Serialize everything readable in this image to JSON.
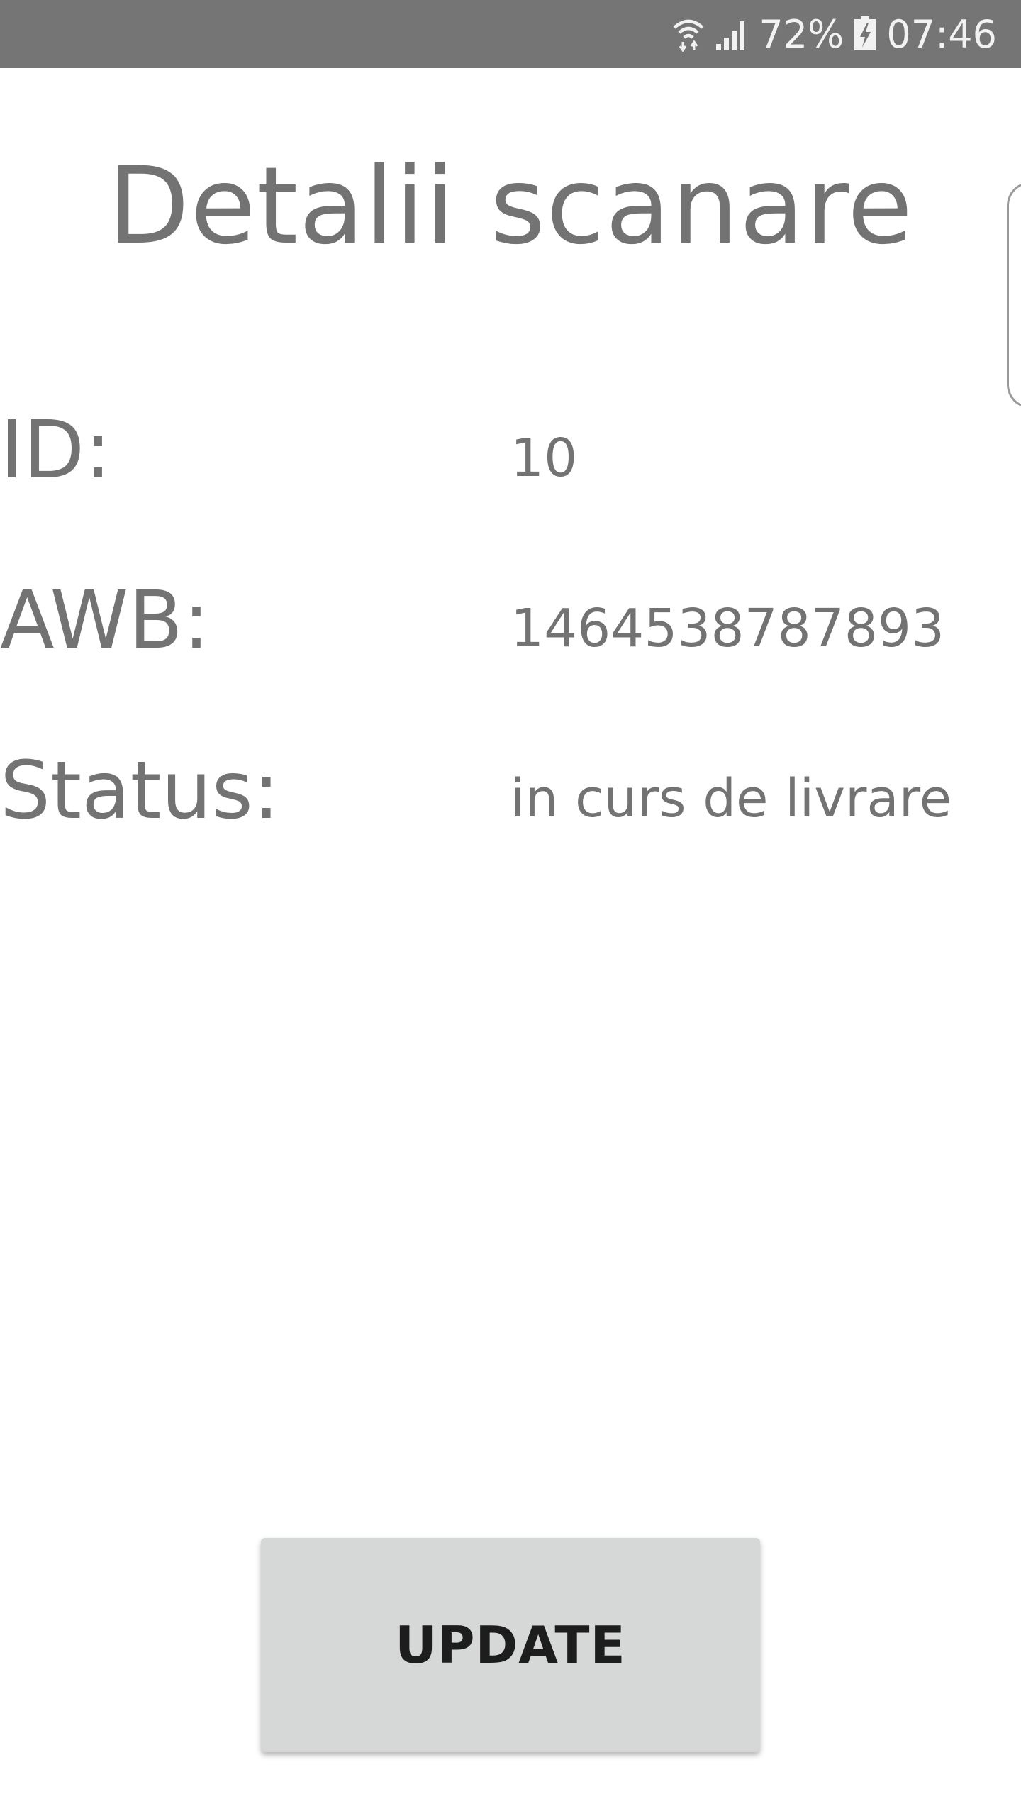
{
  "status_bar": {
    "battery": "72%",
    "time": "07:46",
    "icons": [
      "wifi-icon",
      "signal-icon",
      "battery-charging-icon"
    ]
  },
  "page": {
    "title": "Detalii scanare"
  },
  "details": {
    "id_label": "ID:",
    "id_value": "10",
    "awb_label": "AWB:",
    "awb_value": "1464538787893",
    "status_label": "Status:",
    "status_value": "in curs de livrare"
  },
  "actions": {
    "update_label": "UPDATE"
  },
  "colors": {
    "status_bar_bg": "#757575",
    "text": "#737373",
    "button_bg": "#d6d7d7",
    "button_text": "#1d1d1d"
  }
}
